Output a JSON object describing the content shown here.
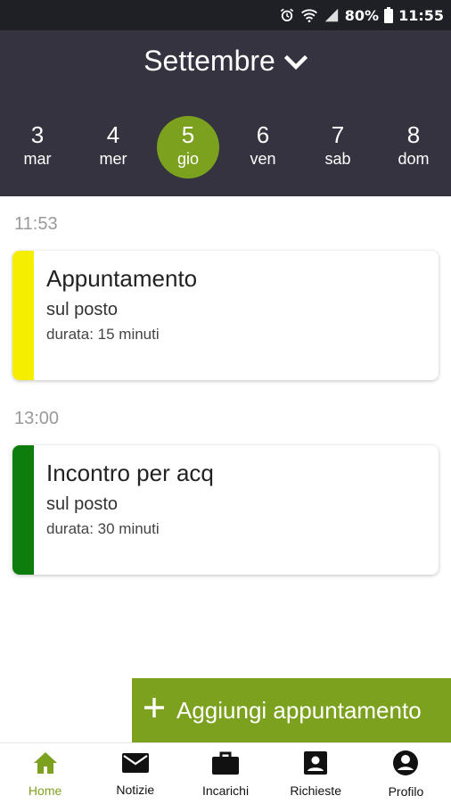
{
  "status_bar": {
    "battery": "80%",
    "time": "11:55"
  },
  "header": {
    "month": "Settembre",
    "days": [
      {
        "num": "3",
        "wd": "mar"
      },
      {
        "num": "4",
        "wd": "mer"
      },
      {
        "num": "5",
        "wd": "gio",
        "selected": true
      },
      {
        "num": "6",
        "wd": "ven"
      },
      {
        "num": "7",
        "wd": "sab"
      },
      {
        "num": "8",
        "wd": "dom"
      }
    ]
  },
  "appointments": [
    {
      "time": "11:53",
      "title": "Appuntamento",
      "place": "sul posto",
      "duration": "durata: 15 minuti",
      "color": "#f5ee00"
    },
    {
      "time": "13:00",
      "title": "Incontro per acq",
      "place": "sul posto",
      "duration": "durata: 30 minuti",
      "color": "#0d7d0d"
    }
  ],
  "fab": {
    "label": "Aggiungi appuntamento"
  },
  "bottom_nav": [
    {
      "label": "Home",
      "icon": "home-icon",
      "active": true
    },
    {
      "label": "Notizie",
      "icon": "mail-icon"
    },
    {
      "label": "Incarichi",
      "icon": "briefcase-icon"
    },
    {
      "label": "Richieste",
      "icon": "contact-card-icon"
    },
    {
      "label": "Profilo",
      "icon": "account-circle-icon"
    }
  ],
  "colors": {
    "accent": "#7ca11f",
    "header_bg": "#34333f",
    "status_bg": "#1f1f26"
  }
}
